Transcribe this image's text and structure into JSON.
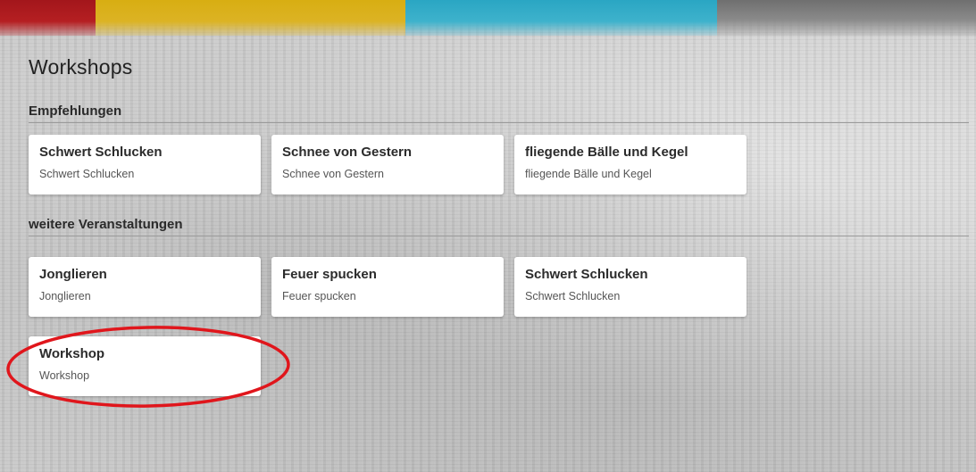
{
  "page": {
    "title": "Workshops"
  },
  "sections": [
    {
      "title": "Empfehlungen",
      "cards": [
        {
          "title": "Schwert Schlucken",
          "subtitle": "Schwert Schlucken"
        },
        {
          "title": "Schnee von Gestern",
          "subtitle": "Schnee von Gestern"
        },
        {
          "title": "fliegende Bälle und Kegel",
          "subtitle": "fliegende Bälle und Kegel"
        }
      ]
    },
    {
      "title": "weitere Veranstaltungen",
      "cards": [
        {
          "title": "Jonglieren",
          "subtitle": "Jonglieren"
        },
        {
          "title": "Feuer spucken",
          "subtitle": "Feuer spucken"
        },
        {
          "title": "Schwert Schlucken",
          "subtitle": "Schwert Schlucken"
        },
        {
          "title": "Workshop",
          "subtitle": "Workshop"
        }
      ]
    }
  ],
  "colors": {
    "banner": [
      "#a3161b",
      "#d8ae12",
      "#2aa6c3",
      "#7a7a7a"
    ],
    "highlight_ring": "#e0161c",
    "card_background": "#ffffff"
  }
}
